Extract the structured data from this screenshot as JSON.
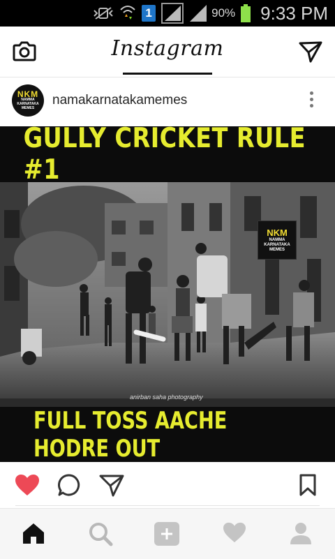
{
  "status_bar": {
    "sim_badge": "1",
    "battery_percent": "90%",
    "time": "9:33 PM"
  },
  "header": {
    "logo_text": "Instagram"
  },
  "post": {
    "avatar": {
      "badge_text": "NKM",
      "sub_text": "NAMMA KARNATAKA MEMES"
    },
    "username": "namakarnatakamemes",
    "image": {
      "top_caption": "GULLY CRICKET RULE #1",
      "bottom_caption": "FULL TOSS AACHE HODRE OUT",
      "photo_credit": "anirban saha photography",
      "watermark": {
        "badge_text": "NKM",
        "sub_text": "NAMMA KARNATAKA MEMES"
      }
    },
    "liked": true
  },
  "icons": {
    "camera": "camera-icon",
    "send": "direct-send-icon",
    "more": "more-options-icon",
    "like": "heart-icon",
    "comment": "comment-icon",
    "share": "share-icon",
    "save": "bookmark-icon",
    "home": "home-icon",
    "search": "search-icon",
    "add": "add-post-icon",
    "activity": "activity-heart-icon",
    "profile": "profile-icon"
  },
  "colors": {
    "like_red": "#ed4956",
    "meme_yellow": "#e6ec2f",
    "battery_green": "#8ee04b"
  }
}
